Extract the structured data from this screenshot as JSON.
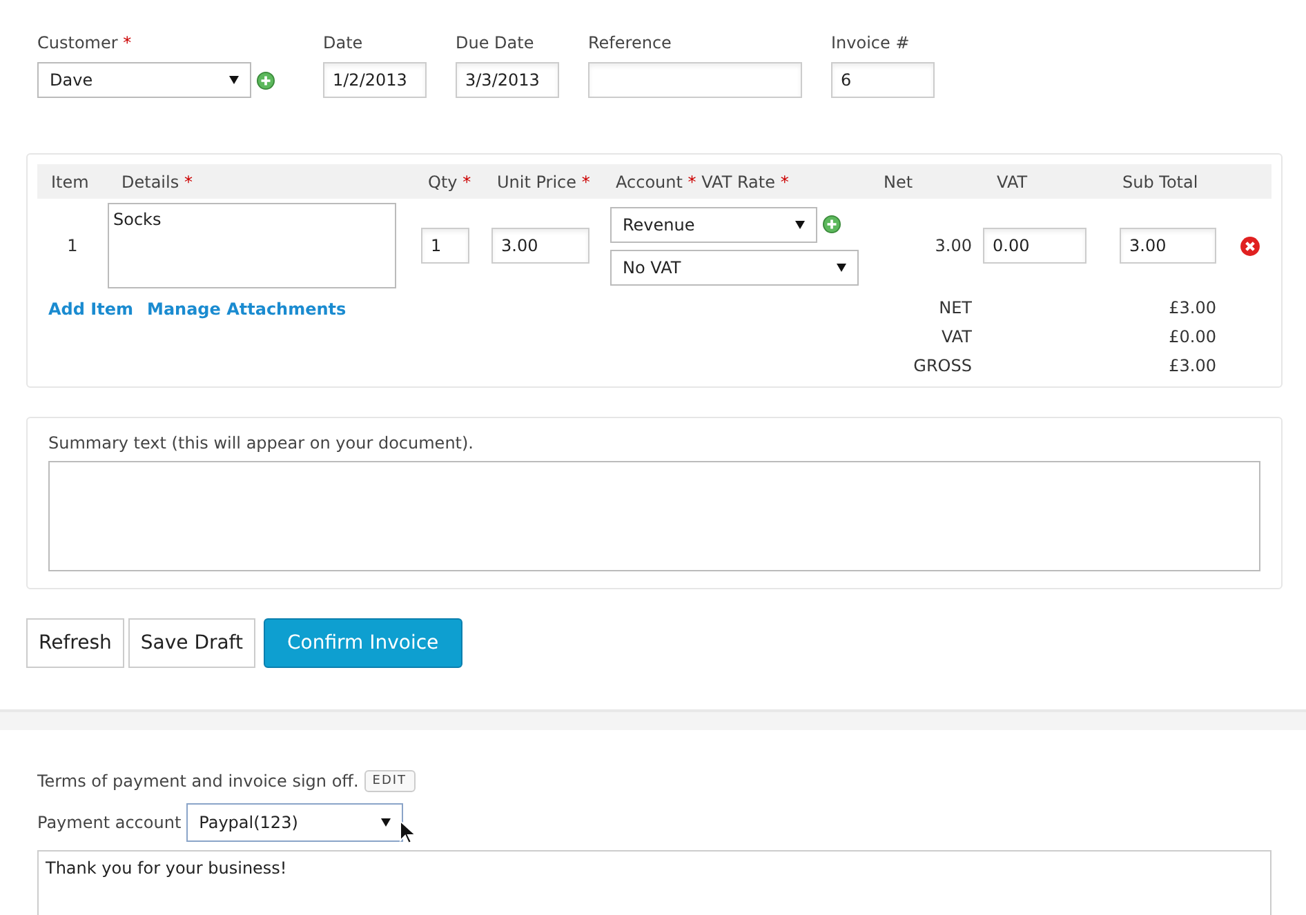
{
  "header_fields": [
    {
      "kind": "select",
      "label": "Customer",
      "mark": "*",
      "value": "Dave"
    },
    {
      "kind": "text",
      "label": "Date",
      "value": "1/2/2013"
    },
    {
      "kind": "text",
      "label": "Due Date",
      "value": "3/3/2013"
    },
    {
      "kind": "text",
      "label": "Reference"
    },
    {
      "kind": "text",
      "label": "Invoice #",
      "value": "6"
    }
  ],
  "table": {
    "columns": [
      [
        {
          "label": "Item"
        }
      ],
      [
        {
          "label": "Details",
          "mark": "*"
        }
      ],
      [
        {
          "label": "Qty",
          "mark": "*"
        }
      ],
      [
        {
          "label": "Unit Price",
          "mark": "*"
        }
      ],
      [
        {
          "label": "Account",
          "mark": "*"
        },
        {
          "label": "VAT Rate",
          "mark": "*"
        }
      ],
      [
        {
          "label": "Net"
        }
      ],
      [
        {
          "label": "VAT"
        }
      ],
      [
        {
          "label": "Sub Total"
        }
      ]
    ],
    "rows": [
      {
        "item": "1",
        "details": "Socks",
        "qty": "1",
        "unit_price": "3.00",
        "account": "Revenue",
        "vat_rate": "No VAT",
        "net": "3.00",
        "vat": "0.00",
        "sub_total": "3.00"
      }
    ],
    "links": [
      "Add Item",
      "Manage Attachments"
    ],
    "totals": [
      {
        "label": "NET",
        "value": "£3.00"
      },
      {
        "label": "VAT",
        "value": "£0.00"
      },
      {
        "label": "GROSS",
        "value": "£3.00"
      }
    ]
  },
  "summary": {
    "label": "Summary text (this will appear on your document)."
  },
  "buttons": [
    {
      "label": "Refresh",
      "kind": "default"
    },
    {
      "label": "Save Draft",
      "kind": "default"
    },
    {
      "label": "Confirm Invoice",
      "kind": "primary"
    }
  ],
  "terms": {
    "label": "Terms of payment and invoice sign off.",
    "edit": "EDIT",
    "payment_label": "Payment account",
    "payment_value": "Paypal(123)",
    "text": "Thank you for your business!"
  }
}
